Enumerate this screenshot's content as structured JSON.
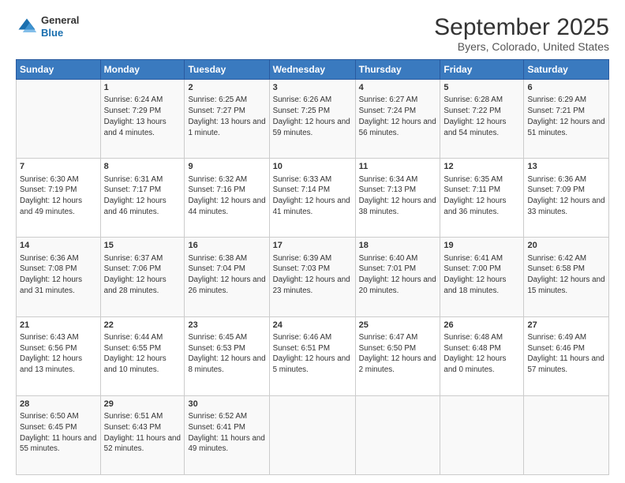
{
  "logo": {
    "line1": "General",
    "line2": "Blue"
  },
  "title": "September 2025",
  "subtitle": "Byers, Colorado, United States",
  "days": [
    "Sunday",
    "Monday",
    "Tuesday",
    "Wednesday",
    "Thursday",
    "Friday",
    "Saturday"
  ],
  "weeks": [
    [
      {
        "date": "",
        "sunrise": "",
        "sunset": "",
        "daylight": ""
      },
      {
        "date": "1",
        "sunrise": "Sunrise: 6:24 AM",
        "sunset": "Sunset: 7:29 PM",
        "daylight": "Daylight: 13 hours and 4 minutes."
      },
      {
        "date": "2",
        "sunrise": "Sunrise: 6:25 AM",
        "sunset": "Sunset: 7:27 PM",
        "daylight": "Daylight: 13 hours and 1 minute."
      },
      {
        "date": "3",
        "sunrise": "Sunrise: 6:26 AM",
        "sunset": "Sunset: 7:25 PM",
        "daylight": "Daylight: 12 hours and 59 minutes."
      },
      {
        "date": "4",
        "sunrise": "Sunrise: 6:27 AM",
        "sunset": "Sunset: 7:24 PM",
        "daylight": "Daylight: 12 hours and 56 minutes."
      },
      {
        "date": "5",
        "sunrise": "Sunrise: 6:28 AM",
        "sunset": "Sunset: 7:22 PM",
        "daylight": "Daylight: 12 hours and 54 minutes."
      },
      {
        "date": "6",
        "sunrise": "Sunrise: 6:29 AM",
        "sunset": "Sunset: 7:21 PM",
        "daylight": "Daylight: 12 hours and 51 minutes."
      }
    ],
    [
      {
        "date": "7",
        "sunrise": "Sunrise: 6:30 AM",
        "sunset": "Sunset: 7:19 PM",
        "daylight": "Daylight: 12 hours and 49 minutes."
      },
      {
        "date": "8",
        "sunrise": "Sunrise: 6:31 AM",
        "sunset": "Sunset: 7:17 PM",
        "daylight": "Daylight: 12 hours and 46 minutes."
      },
      {
        "date": "9",
        "sunrise": "Sunrise: 6:32 AM",
        "sunset": "Sunset: 7:16 PM",
        "daylight": "Daylight: 12 hours and 44 minutes."
      },
      {
        "date": "10",
        "sunrise": "Sunrise: 6:33 AM",
        "sunset": "Sunset: 7:14 PM",
        "daylight": "Daylight: 12 hours and 41 minutes."
      },
      {
        "date": "11",
        "sunrise": "Sunrise: 6:34 AM",
        "sunset": "Sunset: 7:13 PM",
        "daylight": "Daylight: 12 hours and 38 minutes."
      },
      {
        "date": "12",
        "sunrise": "Sunrise: 6:35 AM",
        "sunset": "Sunset: 7:11 PM",
        "daylight": "Daylight: 12 hours and 36 minutes."
      },
      {
        "date": "13",
        "sunrise": "Sunrise: 6:36 AM",
        "sunset": "Sunset: 7:09 PM",
        "daylight": "Daylight: 12 hours and 33 minutes."
      }
    ],
    [
      {
        "date": "14",
        "sunrise": "Sunrise: 6:36 AM",
        "sunset": "Sunset: 7:08 PM",
        "daylight": "Daylight: 12 hours and 31 minutes."
      },
      {
        "date": "15",
        "sunrise": "Sunrise: 6:37 AM",
        "sunset": "Sunset: 7:06 PM",
        "daylight": "Daylight: 12 hours and 28 minutes."
      },
      {
        "date": "16",
        "sunrise": "Sunrise: 6:38 AM",
        "sunset": "Sunset: 7:04 PM",
        "daylight": "Daylight: 12 hours and 26 minutes."
      },
      {
        "date": "17",
        "sunrise": "Sunrise: 6:39 AM",
        "sunset": "Sunset: 7:03 PM",
        "daylight": "Daylight: 12 hours and 23 minutes."
      },
      {
        "date": "18",
        "sunrise": "Sunrise: 6:40 AM",
        "sunset": "Sunset: 7:01 PM",
        "daylight": "Daylight: 12 hours and 20 minutes."
      },
      {
        "date": "19",
        "sunrise": "Sunrise: 6:41 AM",
        "sunset": "Sunset: 7:00 PM",
        "daylight": "Daylight: 12 hours and 18 minutes."
      },
      {
        "date": "20",
        "sunrise": "Sunrise: 6:42 AM",
        "sunset": "Sunset: 6:58 PM",
        "daylight": "Daylight: 12 hours and 15 minutes."
      }
    ],
    [
      {
        "date": "21",
        "sunrise": "Sunrise: 6:43 AM",
        "sunset": "Sunset: 6:56 PM",
        "daylight": "Daylight: 12 hours and 13 minutes."
      },
      {
        "date": "22",
        "sunrise": "Sunrise: 6:44 AM",
        "sunset": "Sunset: 6:55 PM",
        "daylight": "Daylight: 12 hours and 10 minutes."
      },
      {
        "date": "23",
        "sunrise": "Sunrise: 6:45 AM",
        "sunset": "Sunset: 6:53 PM",
        "daylight": "Daylight: 12 hours and 8 minutes."
      },
      {
        "date": "24",
        "sunrise": "Sunrise: 6:46 AM",
        "sunset": "Sunset: 6:51 PM",
        "daylight": "Daylight: 12 hours and 5 minutes."
      },
      {
        "date": "25",
        "sunrise": "Sunrise: 6:47 AM",
        "sunset": "Sunset: 6:50 PM",
        "daylight": "Daylight: 12 hours and 2 minutes."
      },
      {
        "date": "26",
        "sunrise": "Sunrise: 6:48 AM",
        "sunset": "Sunset: 6:48 PM",
        "daylight": "Daylight: 12 hours and 0 minutes."
      },
      {
        "date": "27",
        "sunrise": "Sunrise: 6:49 AM",
        "sunset": "Sunset: 6:46 PM",
        "daylight": "Daylight: 11 hours and 57 minutes."
      }
    ],
    [
      {
        "date": "28",
        "sunrise": "Sunrise: 6:50 AM",
        "sunset": "Sunset: 6:45 PM",
        "daylight": "Daylight: 11 hours and 55 minutes."
      },
      {
        "date": "29",
        "sunrise": "Sunrise: 6:51 AM",
        "sunset": "Sunset: 6:43 PM",
        "daylight": "Daylight: 11 hours and 52 minutes."
      },
      {
        "date": "30",
        "sunrise": "Sunrise: 6:52 AM",
        "sunset": "Sunset: 6:41 PM",
        "daylight": "Daylight: 11 hours and 49 minutes."
      },
      {
        "date": "",
        "sunrise": "",
        "sunset": "",
        "daylight": ""
      },
      {
        "date": "",
        "sunrise": "",
        "sunset": "",
        "daylight": ""
      },
      {
        "date": "",
        "sunrise": "",
        "sunset": "",
        "daylight": ""
      },
      {
        "date": "",
        "sunrise": "",
        "sunset": "",
        "daylight": ""
      }
    ]
  ]
}
